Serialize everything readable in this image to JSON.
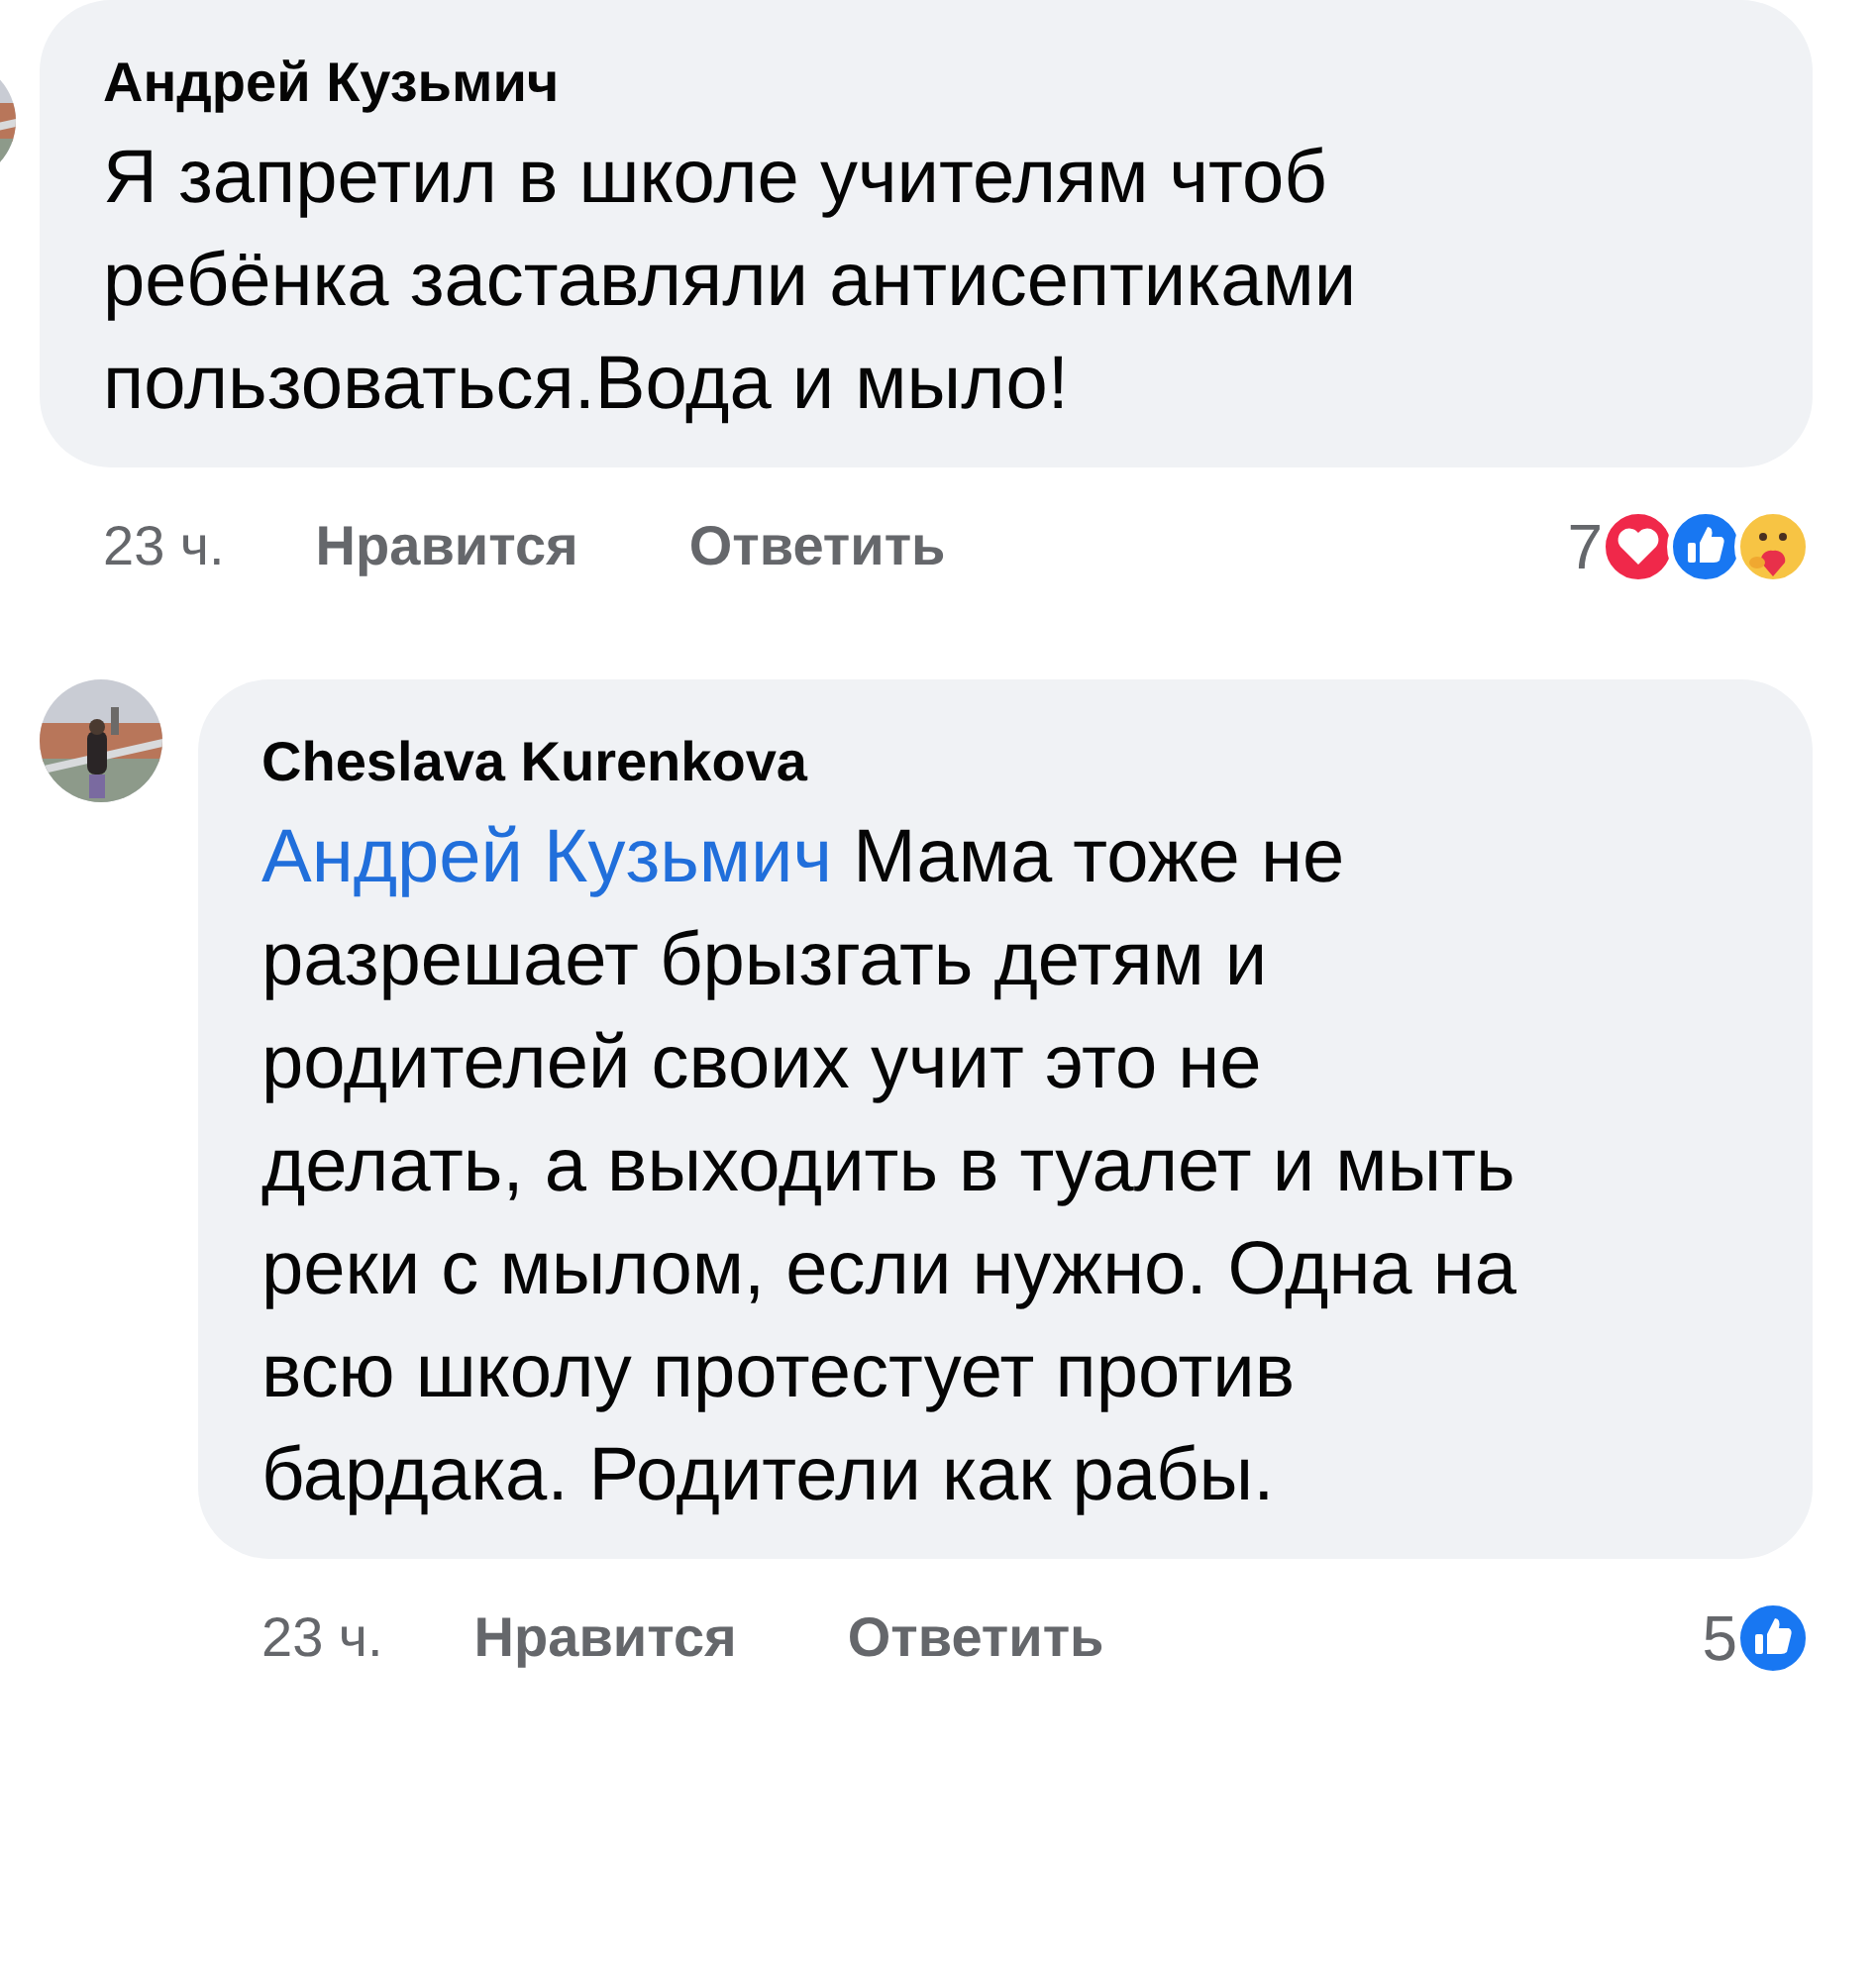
{
  "comments": [
    {
      "author": "Андрей Кузьмич",
      "avatar": {
        "kind": "picture",
        "cut": true
      },
      "text": "Я запретил в школе учителям чтоб ребёнка заставляли антисептиками пользоваться.Вода и мыло!",
      "time": "23 ч.",
      "actions": [
        "Нравится",
        "Ответить"
      ],
      "reaction_count": "7",
      "reactions": [
        {
          "kind": "love"
        },
        {
          "kind": "like"
        },
        {
          "kind": "care"
        }
      ]
    },
    {
      "author": "Cheslava Kurenkova",
      "avatar": {
        "kind": "picture",
        "cut": false
      },
      "mention": "Андрей Кузьмич",
      "text": "Мама тоже не разрешает брызгать детям и родителей своих учит это не делать, а выходить в туалет и мыть реки с мылом, если нужно. Одна на всю школу протестует против бардака. Родители как рабы.",
      "time": "23 ч.",
      "actions": [
        "Нравится",
        "Ответить"
      ],
      "reaction_count": "5",
      "reactions": [
        {
          "kind": "like"
        }
      ]
    }
  ]
}
